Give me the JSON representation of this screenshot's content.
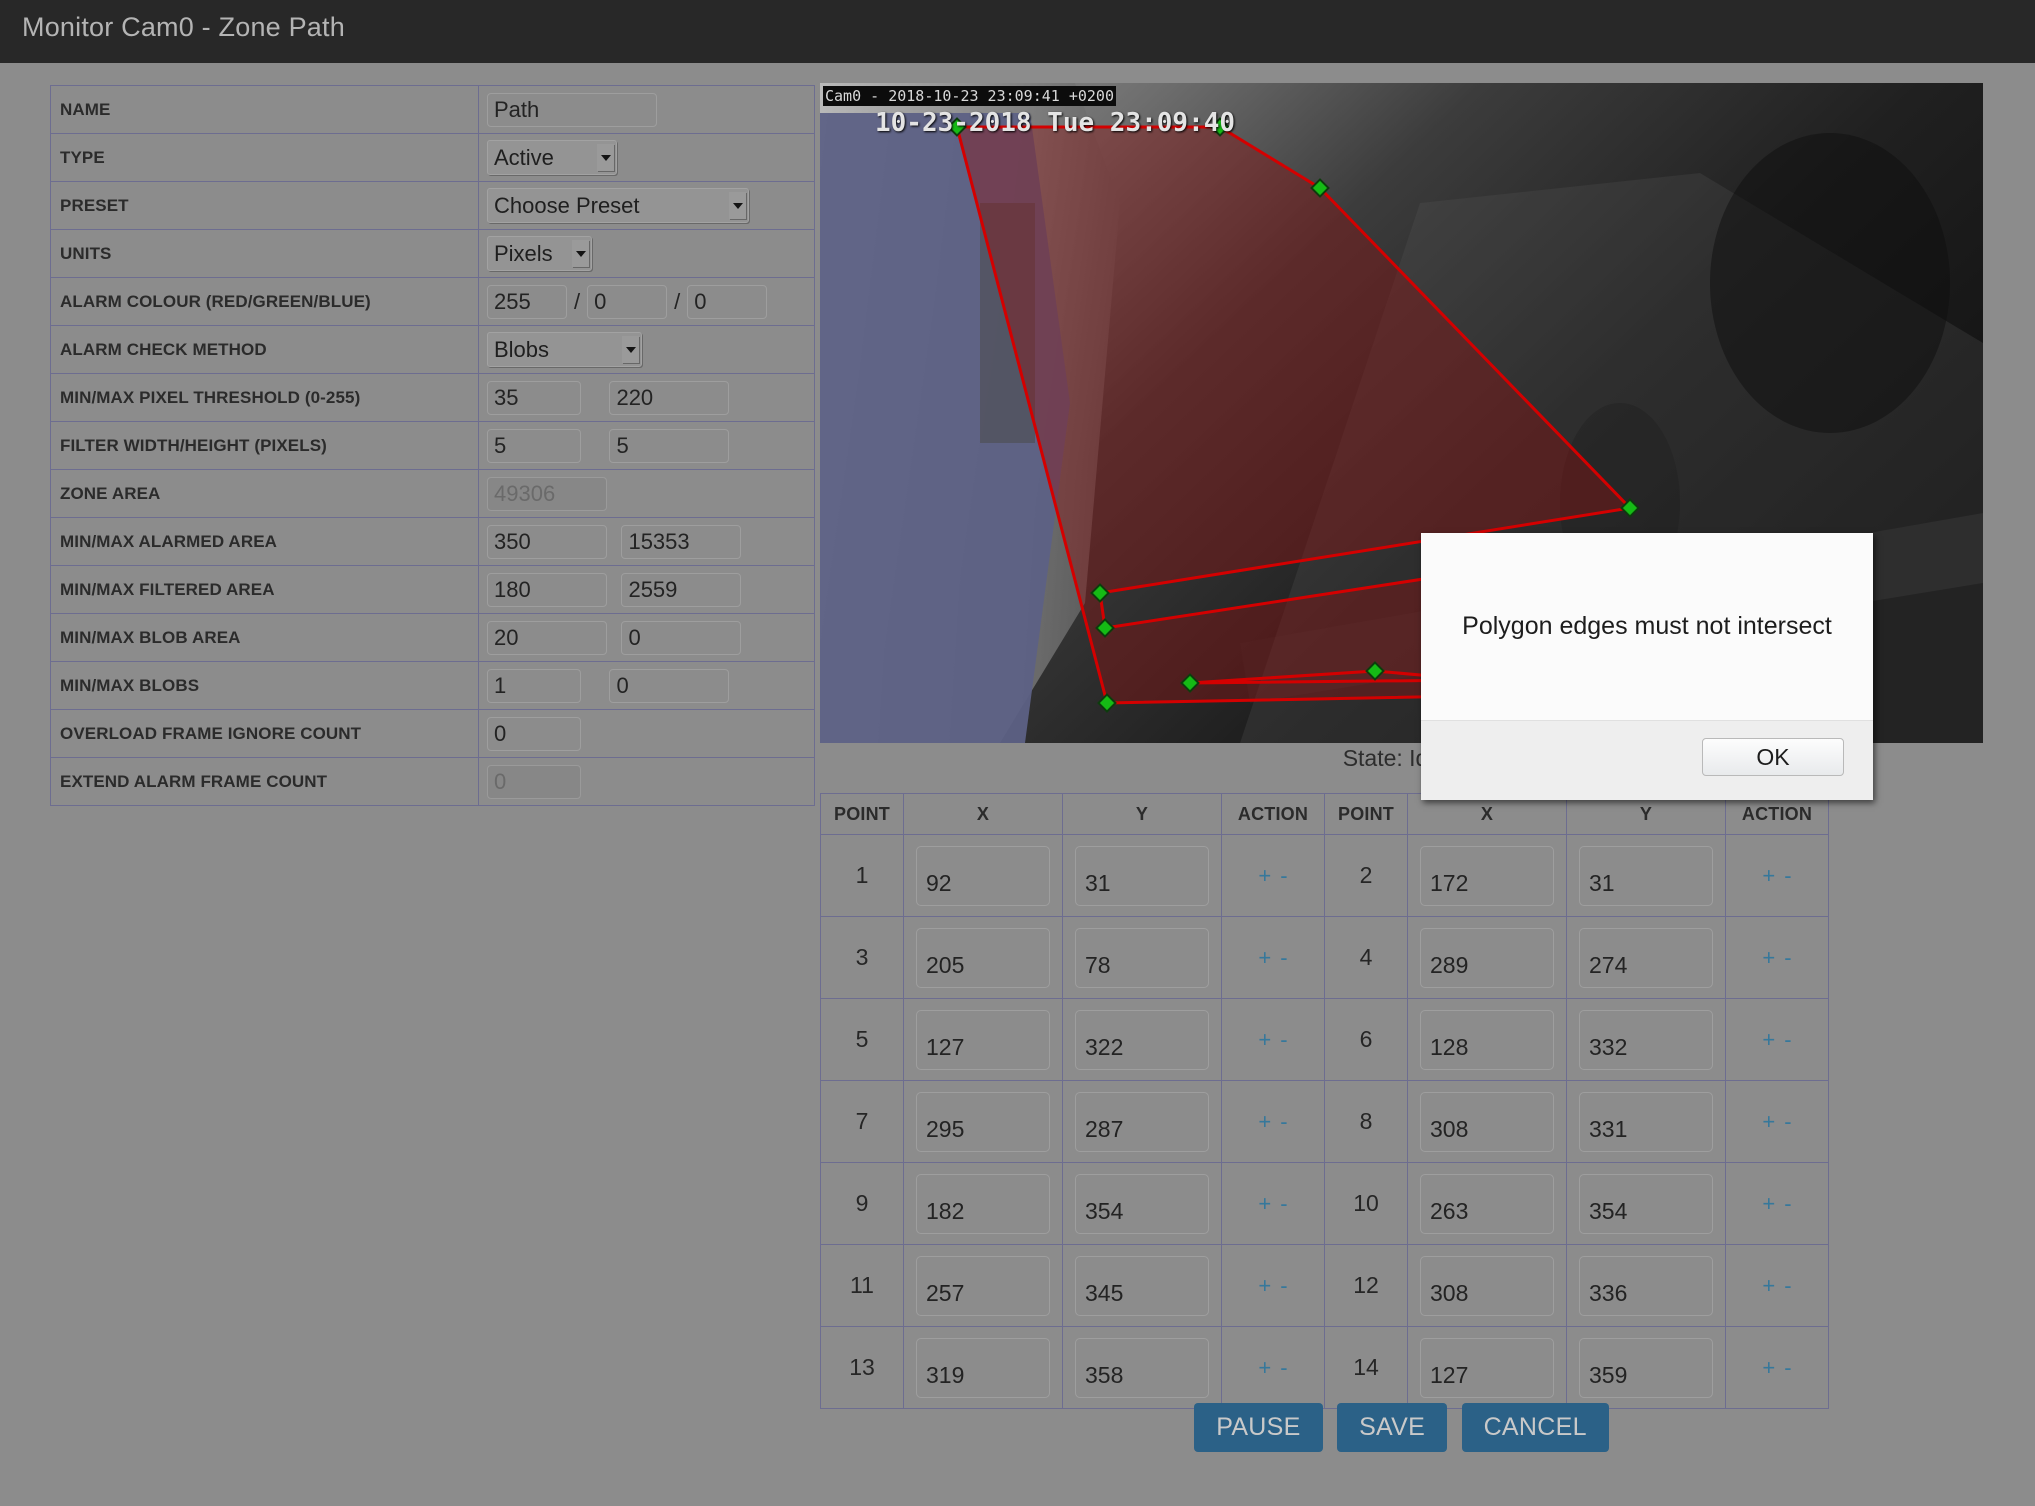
{
  "window": {
    "title": "Monitor Cam0 - Zone Path"
  },
  "form": {
    "rows": {
      "name": {
        "label": "NAME",
        "value": "Path"
      },
      "type": {
        "label": "TYPE",
        "value": "Active"
      },
      "preset": {
        "label": "PRESET",
        "value": "Choose Preset"
      },
      "units": {
        "label": "UNITS",
        "value": "Pixels"
      },
      "alarm_colour": {
        "label": "ALARM COLOUR (RED/GREEN/BLUE)",
        "red": "255",
        "green": "0",
        "blue": "0",
        "sep": "/"
      },
      "check_method": {
        "label": "ALARM CHECK METHOD",
        "value": "Blobs"
      },
      "pixel_threshold": {
        "label": "MIN/MAX PIXEL THRESHOLD (0-255)",
        "min": "35",
        "max": "220"
      },
      "filter_wh": {
        "label": "FILTER WIDTH/HEIGHT (PIXELS)",
        "min": "5",
        "max": "5"
      },
      "zone_area": {
        "label": "ZONE AREA",
        "value": "49306"
      },
      "alarmed_area": {
        "label": "MIN/MAX ALARMED AREA",
        "min": "350",
        "max": "15353"
      },
      "filtered_area": {
        "label": "MIN/MAX FILTERED AREA",
        "min": "180",
        "max": "2559"
      },
      "blob_area": {
        "label": "MIN/MAX BLOB AREA",
        "min": "20",
        "max": "0"
      },
      "blobs": {
        "label": "MIN/MAX BLOBS",
        "min": "1",
        "max": "0"
      },
      "overload_ignore": {
        "label": "OVERLOAD FRAME IGNORE COUNT",
        "value": "0"
      },
      "extend_alarm": {
        "label": "EXTEND ALARM FRAME COUNT",
        "value": "0"
      }
    }
  },
  "feed": {
    "overlay_label": "Cam0 - 2018-10-23 23:09:41 +0200",
    "embedded_timestamp": "10-23-2018 Tue 23:09:40",
    "state_text": "State: Idle -",
    "zone_fill_colour": "#7c1f1f",
    "zone_edge_colour": "#d60000",
    "vertex_colour": "#1fbb1f"
  },
  "points": {
    "headers": {
      "point": "POINT",
      "x": "X",
      "y": "Y",
      "action": "ACTION"
    },
    "action_add": "+",
    "action_remove": "-",
    "list": [
      {
        "n": "1",
        "x": "92",
        "y": "31"
      },
      {
        "n": "2",
        "x": "172",
        "y": "31"
      },
      {
        "n": "3",
        "x": "205",
        "y": "78"
      },
      {
        "n": "4",
        "x": "289",
        "y": "274"
      },
      {
        "n": "5",
        "x": "127",
        "y": "322"
      },
      {
        "n": "6",
        "x": "128",
        "y": "332"
      },
      {
        "n": "7",
        "x": "295",
        "y": "287"
      },
      {
        "n": "8",
        "x": "308",
        "y": "331"
      },
      {
        "n": "9",
        "x": "182",
        "y": "354"
      },
      {
        "n": "10",
        "x": "263",
        "y": "354"
      },
      {
        "n": "11",
        "x": "257",
        "y": "345"
      },
      {
        "n": "12",
        "x": "308",
        "y": "336"
      },
      {
        "n": "13",
        "x": "319",
        "y": "358"
      },
      {
        "n": "14",
        "x": "127",
        "y": "359"
      }
    ]
  },
  "buttons": {
    "pause": "PAUSE",
    "save": "SAVE",
    "cancel": "CANCEL",
    "accent_colour": "#2b6187"
  },
  "alert": {
    "message": "Polygon edges must not intersect",
    "ok": "OK"
  }
}
